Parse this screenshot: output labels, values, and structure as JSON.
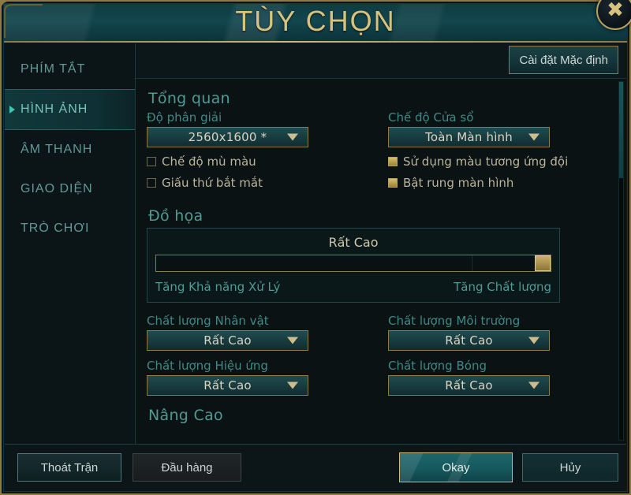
{
  "window": {
    "title": "TÙY CHỌN",
    "close_icon": "close-x-icon"
  },
  "sidebar": {
    "items": [
      {
        "label": "PHÍM TẮT",
        "active": false
      },
      {
        "label": "HÌNH ẢNH",
        "active": true
      },
      {
        "label": "ÂM THANH",
        "active": false
      },
      {
        "label": "GIAO DIỆN",
        "active": false
      },
      {
        "label": "TRÒ CHƠI",
        "active": false
      }
    ]
  },
  "toolbar": {
    "default_settings_label": "Cài đặt Mặc định"
  },
  "sections": {
    "overview": {
      "heading": "Tổng quan",
      "resolution": {
        "label": "Độ phân giải",
        "value": "2560x1600 *",
        "arrow_icon": "chevron-down-icon"
      },
      "window_mode": {
        "label": "Chế độ Cửa sổ",
        "value": "Toàn Màn hình",
        "arrow_icon": "chevron-down-icon"
      },
      "checkboxes_left": [
        {
          "label": "Chế độ mù màu",
          "checked": false
        },
        {
          "label": "Giấu thứ bắt mắt",
          "checked": false
        }
      ],
      "checkboxes_right": [
        {
          "label": "Sử dụng màu tương ứng đội",
          "checked": true
        },
        {
          "label": "Bật rung màn hình",
          "checked": true
        }
      ]
    },
    "graphics": {
      "heading": "Đồ họa",
      "slider": {
        "value_label": "Rất Cao",
        "percent": 100,
        "left_label": "Tăng Khả năng Xử Lý",
        "right_label": "Tăng Chất lượng"
      },
      "quality": [
        {
          "label": "Chất lượng Nhân vật",
          "value": "Rất Cao",
          "arrow_icon": "chevron-down-icon"
        },
        {
          "label": "Chất lượng Môi trường",
          "value": "Rất Cao",
          "arrow_icon": "chevron-down-icon"
        },
        {
          "label": "Chất lượng Hiệu ứng",
          "value": "Rất Cao",
          "arrow_icon": "chevron-down-icon"
        },
        {
          "label": "Chất lượng Bóng",
          "value": "Rất Cao",
          "arrow_icon": "chevron-down-icon"
        }
      ]
    },
    "advanced": {
      "heading": "Nâng Cao"
    }
  },
  "footer": {
    "exit_match": "Thoát Trận",
    "surrender": "Đầu hàng",
    "okay": "Okay",
    "cancel": "Hủy"
  },
  "colors": {
    "gold": "#cdb97a",
    "teal": "#4f9b94",
    "panel_bg": "#0a1214",
    "title_bg": "#12464e"
  }
}
